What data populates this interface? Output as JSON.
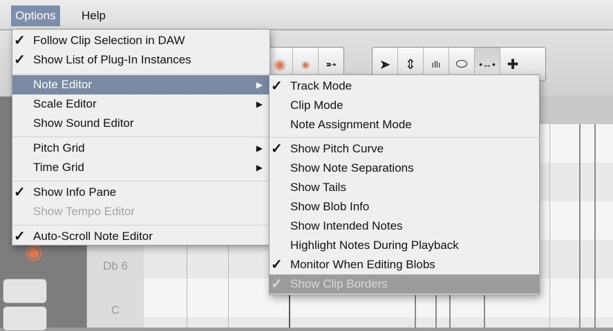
{
  "menubar": {
    "options_label": "Options",
    "help_label": "Help"
  },
  "options_menu": {
    "items": [
      {
        "label": "Follow Clip Selection in DAW",
        "checked": true
      },
      {
        "label": "Show List of Plug-In Instances",
        "checked": true
      },
      {
        "label": "Note Editor",
        "checked": false,
        "submenu": true,
        "highlighted": true
      },
      {
        "label": "Scale Editor",
        "checked": false,
        "submenu": true
      },
      {
        "label": "Show Sound Editor",
        "checked": false
      },
      {
        "label": "Pitch Grid",
        "checked": false,
        "submenu": true
      },
      {
        "label": "Time Grid",
        "checked": false,
        "submenu": true
      },
      {
        "label": "Show Info Pane",
        "checked": true
      },
      {
        "label": "Show Tempo Editor",
        "checked": false,
        "disabled": true
      },
      {
        "label": "Auto-Scroll Note Editor",
        "checked": true
      }
    ]
  },
  "note_editor_menu": {
    "items": [
      {
        "label": "Track Mode",
        "checked": true
      },
      {
        "label": "Clip Mode",
        "checked": false
      },
      {
        "label": "Note Assignment Mode",
        "checked": false
      },
      {
        "label": "Show Pitch Curve",
        "checked": true
      },
      {
        "label": "Show Note Separations",
        "checked": false
      },
      {
        "label": "Show Tails",
        "checked": false
      },
      {
        "label": "Show Blob Info",
        "checked": false
      },
      {
        "label": "Show Intended Notes",
        "checked": false
      },
      {
        "label": "Highlight Notes During Playback",
        "checked": false
      },
      {
        "label": "Monitor When Editing Blobs",
        "checked": true
      },
      {
        "label": "Show Clip Borders",
        "checked": true,
        "hovered": true
      }
    ]
  },
  "piano_keys": {
    "db6": "Db 6",
    "c": "C"
  },
  "glyphs": {
    "check": "✓",
    "submenu_arrow": "▶"
  },
  "toolbar": {
    "icons": [
      "blob-icon",
      "blob-small-icon",
      "wrench-icon",
      "arrow-pointer-icon",
      "pitch-tool-icon",
      "amplitude-tool-icon",
      "blob-shape-icon",
      "time-stretch-icon",
      "crosshair-icon"
    ]
  },
  "colors": {
    "menu_highlight": "#7a8aa3",
    "menu_bg": "#efefef",
    "blob_accent": "#e07a4f"
  }
}
